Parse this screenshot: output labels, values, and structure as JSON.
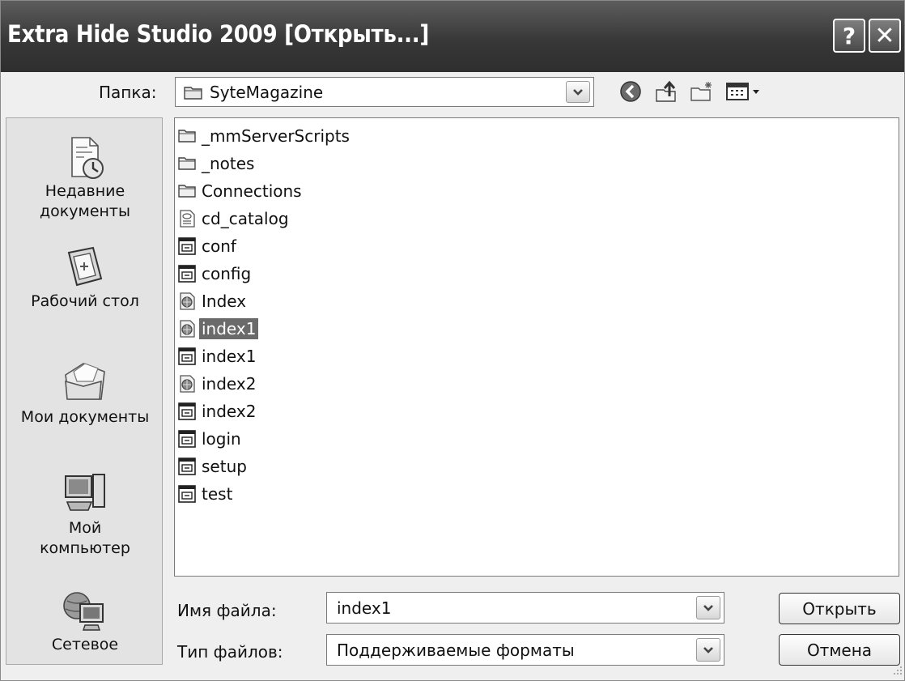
{
  "window": {
    "title": "Extra Hide Studio 2009 [Открыть...]",
    "help_button": "?",
    "close_button": "✕"
  },
  "lookin": {
    "label": "Папка:",
    "value": "SyteMagazine"
  },
  "navbar": {
    "icons": [
      "back-icon",
      "up-folder-icon",
      "new-folder-icon",
      "views-menu-icon"
    ]
  },
  "places": [
    {
      "label_lines": [
        "Недавние",
        "документы"
      ],
      "icon": "recent-documents-icon"
    },
    {
      "label_lines": [
        "Рабочий стол"
      ],
      "icon": "desktop-icon"
    },
    {
      "label_lines": [
        "Мои документы"
      ],
      "icon": "my-documents-icon"
    },
    {
      "label_lines": [
        "Мой",
        "компьютер"
      ],
      "icon": "my-computer-icon"
    },
    {
      "label_lines": [
        "Сетевое"
      ],
      "icon": "network-icon"
    }
  ],
  "files": [
    {
      "name": "_mmServerScripts",
      "type": "folder"
    },
    {
      "name": "_notes",
      "type": "folder"
    },
    {
      "name": "Connections",
      "type": "folder"
    },
    {
      "name": "cd_catalog",
      "type": "xml"
    },
    {
      "name": "conf",
      "type": "page"
    },
    {
      "name": "config",
      "type": "page"
    },
    {
      "name": "Index",
      "type": "web"
    },
    {
      "name": "index1",
      "type": "web",
      "selected": true
    },
    {
      "name": "index1",
      "type": "page"
    },
    {
      "name": "index2",
      "type": "web"
    },
    {
      "name": "index2",
      "type": "page"
    },
    {
      "name": "login",
      "type": "page"
    },
    {
      "name": "setup",
      "type": "page"
    },
    {
      "name": "test",
      "type": "page"
    }
  ],
  "filename": {
    "label": "Имя файла:",
    "value": "index1"
  },
  "filetype": {
    "label": "Тип файлов:",
    "value": "Поддерживаемые форматы"
  },
  "buttons": {
    "open": "Открыть",
    "cancel": "Отмена"
  }
}
